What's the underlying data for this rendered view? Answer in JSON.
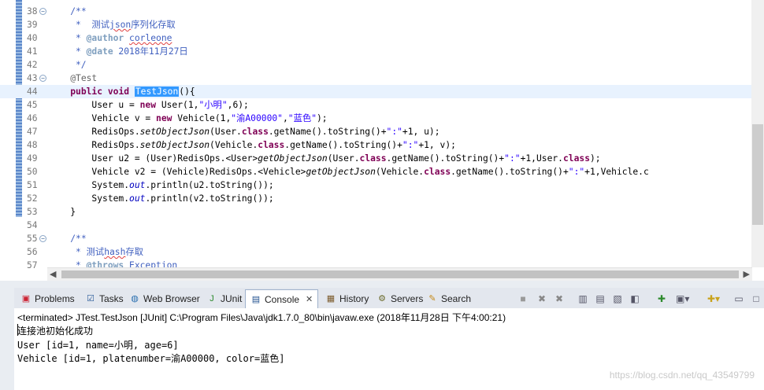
{
  "editor": {
    "lines": [
      {
        "n": "38",
        "fold": true,
        "cur": false,
        "toks": [
          [
            "    ",
            ""
          ],
          [
            "/**",
            "c"
          ]
        ]
      },
      {
        "n": "39",
        "fold": false,
        "cur": false,
        "toks": [
          [
            "     *  测试",
            "c"
          ],
          [
            "json",
            "c sq"
          ],
          [
            "序列化存取",
            "c"
          ]
        ]
      },
      {
        "n": "40",
        "fold": false,
        "cur": false,
        "toks": [
          [
            "     * ",
            "c"
          ],
          [
            "@author",
            "tag"
          ],
          [
            " ",
            "c"
          ],
          [
            "corleone",
            "c sq"
          ]
        ]
      },
      {
        "n": "41",
        "fold": false,
        "cur": false,
        "toks": [
          [
            "     * ",
            "c"
          ],
          [
            "@date",
            "tag"
          ],
          [
            " 2018年11月27日",
            "c"
          ]
        ]
      },
      {
        "n": "42",
        "fold": false,
        "cur": false,
        "toks": [
          [
            "     */",
            "c"
          ]
        ]
      },
      {
        "n": "43",
        "fold": true,
        "cur": false,
        "toks": [
          [
            "    ",
            ""
          ],
          [
            "@Test",
            "an"
          ]
        ]
      },
      {
        "n": "44",
        "fold": false,
        "cur": true,
        "toks": [
          [
            "    ",
            ""
          ],
          [
            "public",
            "kw"
          ],
          [
            " ",
            ""
          ],
          [
            "void",
            "kw"
          ],
          [
            " ",
            ""
          ],
          [
            "TestJson",
            "sel"
          ],
          [
            "(){",
            ""
          ]
        ]
      },
      {
        "n": "45",
        "fold": false,
        "cur": false,
        "toks": [
          [
            "        User u = ",
            ""
          ],
          [
            "new",
            "kw"
          ],
          [
            " User(1,",
            ""
          ],
          [
            "\"小明\"",
            "st"
          ],
          [
            ",6);",
            ""
          ]
        ]
      },
      {
        "n": "46",
        "fold": false,
        "cur": false,
        "toks": [
          [
            "        Vehicle v = ",
            ""
          ],
          [
            "new",
            "kw"
          ],
          [
            " Vehicle(1,",
            ""
          ],
          [
            "\"渝A00000\"",
            "st"
          ],
          [
            ",",
            ""
          ],
          [
            "\"蓝色\"",
            "st"
          ],
          [
            ");",
            ""
          ]
        ]
      },
      {
        "n": "47",
        "fold": false,
        "cur": false,
        "toks": [
          [
            "        RedisOps.",
            ""
          ],
          [
            "setObjectJson",
            "it"
          ],
          [
            "(User.",
            ""
          ],
          [
            "class",
            "kw"
          ],
          [
            ".getName().toString()+",
            ""
          ],
          [
            "\":\"",
            "st"
          ],
          [
            "+1, u);",
            ""
          ]
        ]
      },
      {
        "n": "48",
        "fold": false,
        "cur": false,
        "toks": [
          [
            "        RedisOps.",
            ""
          ],
          [
            "setObjectJson",
            "it"
          ],
          [
            "(Vehicle.",
            ""
          ],
          [
            "class",
            "kw"
          ],
          [
            ".getName().toString()+",
            ""
          ],
          [
            "\":\"",
            "st"
          ],
          [
            "+1, v);",
            ""
          ]
        ]
      },
      {
        "n": "49",
        "fold": false,
        "cur": false,
        "toks": [
          [
            "        User u2 = (User)RedisOps.<User>",
            ""
          ],
          [
            "getObjectJson",
            "it"
          ],
          [
            "(User.",
            ""
          ],
          [
            "class",
            "kw"
          ],
          [
            ".getName().toString()+",
            ""
          ],
          [
            "\":\"",
            "st"
          ],
          [
            "+1,User.",
            ""
          ],
          [
            "class",
            "kw"
          ],
          [
            ");",
            ""
          ]
        ]
      },
      {
        "n": "50",
        "fold": false,
        "cur": false,
        "toks": [
          [
            "        Vehicle v2 = (Vehicle)RedisOps.<Vehicle>",
            ""
          ],
          [
            "getObjectJson",
            "it"
          ],
          [
            "(Vehicle.",
            ""
          ],
          [
            "class",
            "kw"
          ],
          [
            ".getName().toString()+",
            ""
          ],
          [
            "\":\"",
            "st"
          ],
          [
            "+1,Vehicle.c",
            ""
          ]
        ]
      },
      {
        "n": "51",
        "fold": false,
        "cur": false,
        "toks": [
          [
            "        System.",
            ""
          ],
          [
            "out",
            "fi"
          ],
          [
            ".println(u2.toString());",
            ""
          ]
        ]
      },
      {
        "n": "52",
        "fold": false,
        "cur": false,
        "toks": [
          [
            "        System.",
            ""
          ],
          [
            "out",
            "fi"
          ],
          [
            ".println(v2.toString());",
            ""
          ]
        ]
      },
      {
        "n": "53",
        "fold": false,
        "cur": false,
        "toks": [
          [
            "    }",
            ""
          ]
        ]
      },
      {
        "n": "54",
        "fold": false,
        "cur": false,
        "toks": []
      },
      {
        "n": "55",
        "fold": true,
        "cur": false,
        "toks": [
          [
            "    ",
            ""
          ],
          [
            "/**",
            "c"
          ]
        ]
      },
      {
        "n": "56",
        "fold": false,
        "cur": false,
        "toks": [
          [
            "     * 测试",
            "c"
          ],
          [
            "hash",
            "c sq"
          ],
          [
            "存取",
            "c"
          ]
        ]
      },
      {
        "n": "57",
        "fold": false,
        "cur": false,
        "toks": [
          [
            "     * ",
            "c"
          ],
          [
            "@throws",
            "tag"
          ],
          [
            " Exception",
            "c"
          ]
        ]
      }
    ]
  },
  "tabs": {
    "problems": "Problems",
    "tasks": "Tasks",
    "web_browser": "Web Browser",
    "junit": "JUnit",
    "console": "Console",
    "history": "History",
    "servers": "Servers",
    "search": "Search"
  },
  "console": {
    "terminated": "<terminated> JTest.TestJson [JUnit] C:\\Program Files\\Java\\jdk1.7.0_80\\bin\\javaw.exe (2018年11月28日 下午4:00:21)",
    "output": [
      "连接池初始化成功",
      "User [id=1, name=小明, age=6]",
      "Vehicle [id=1, platenumber=渝A00000, color=蓝色]"
    ]
  },
  "watermark": "https://blog.csdn.net/qq_43549799"
}
